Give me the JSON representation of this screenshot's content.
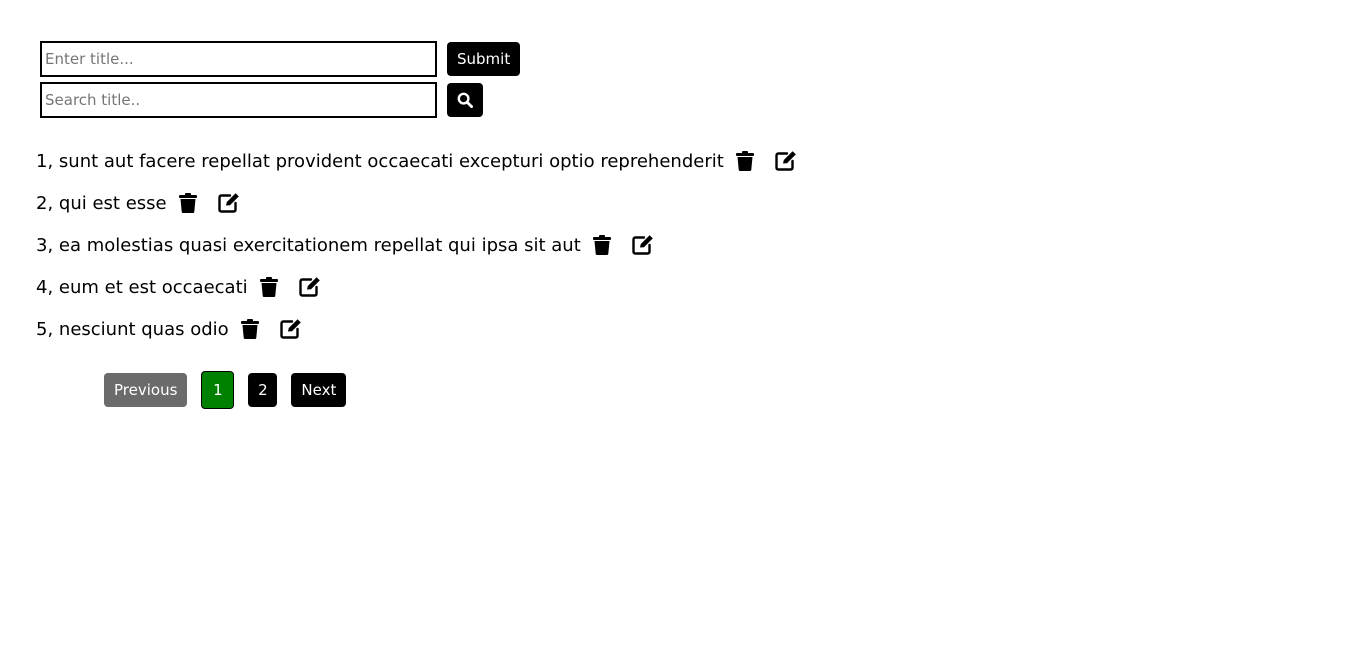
{
  "form": {
    "title_placeholder": "Enter title...",
    "title_value": "",
    "submit_label": "Submit",
    "search_placeholder": "Search title..",
    "search_value": "",
    "search_icon": "search-icon"
  },
  "posts": [
    {
      "id": "1",
      "title": "sunt aut facere repellat provident occaecati excepturi optio reprehenderit"
    },
    {
      "id": "2",
      "title": "qui est esse"
    },
    {
      "id": "3",
      "title": "ea molestias quasi exercitationem repellat qui ipsa sit aut"
    },
    {
      "id": "4",
      "title": "eum et est occaecati"
    },
    {
      "id": "5",
      "title": "nesciunt quas odio"
    }
  ],
  "post_icons": {
    "delete": "trash-icon",
    "edit": "edit-icon"
  },
  "pagination": {
    "previous_label": "Previous",
    "next_label": "Next",
    "pages": [
      "1",
      "2"
    ],
    "current_page": "1",
    "colors": {
      "active": "#008000",
      "disabled": "#6b6b6b",
      "default": "#000000"
    }
  }
}
